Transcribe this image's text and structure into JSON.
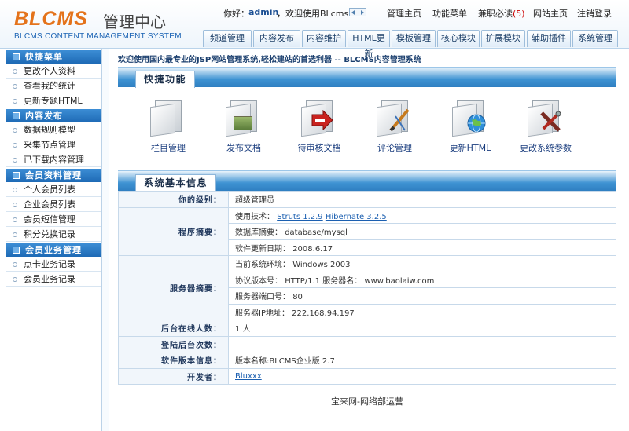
{
  "header": {
    "logo_main": "BLCMS",
    "logo_cn": "管理中心",
    "logo_sub": "BLCMS CONTENT MANAGEMENT SYSTEM",
    "greeting_prefix": "你好：",
    "username": "admin",
    "greeting_suffix": "，欢迎使用BLcms.",
    "links": [
      "管理主页",
      "功能菜单",
      "兼职必读",
      "网站主页",
      "注销登录"
    ],
    "parttime_count": "(5)"
  },
  "nav_tabs": [
    "频道管理",
    "内容发布",
    "内容维护",
    "HTML更新",
    "模板管理",
    "核心模块",
    "扩展模块",
    "辅助插件",
    "系统管理"
  ],
  "sidebar": {
    "sections": [
      {
        "title": "快捷菜单",
        "items": [
          "更改个人资料",
          "查看我的统计",
          "更新专题HTML"
        ]
      },
      {
        "title": "内容发布",
        "items": [
          "数据规则模型",
          "采集节点管理",
          "已下载内容管理"
        ]
      },
      {
        "title": "会员资料管理",
        "items": [
          "个人会员列表",
          "企业会员列表",
          "会员短信管理",
          "积分兑换记录"
        ]
      },
      {
        "title": "会员业务管理",
        "items": [
          "点卡业务记录",
          "会员业务记录"
        ]
      }
    ]
  },
  "main": {
    "welcome": "欢迎使用国内最专业的JSP网站管理系统,轻松建站的首选利器 -- BLCMS内容管理系统",
    "quick_title": "快捷功能",
    "quick_items": [
      {
        "label": "栏目管理",
        "icon": "folder-icon"
      },
      {
        "label": "发布文档",
        "icon": "document-icon"
      },
      {
        "label": "待审核文档",
        "icon": "pending-document-icon"
      },
      {
        "label": "评论管理",
        "icon": "comment-icon"
      },
      {
        "label": "更新HTML",
        "icon": "globe-icon"
      },
      {
        "label": "更改系统参数",
        "icon": "tools-icon"
      }
    ],
    "info_title": "系统基本信息",
    "info": {
      "level_key": "你的级别：",
      "level_val": "超级管理员",
      "program_key": "程序摘要：",
      "tech_label": "使用技术：",
      "tech_struts": "Struts 1.2.9",
      "tech_hibernate": "Hibernate 3.2.5",
      "db_label": "数据库摘要：",
      "db_val": "database/mysql",
      "update_label": "软件更新日期：",
      "update_val": "2008.6.17",
      "server_key": "服务器摘要：",
      "env_label": "当前系统环境：",
      "env_val": "Windows 2003",
      "proto_label": "协议版本号：",
      "proto_val": "HTTP/1.1",
      "sname_label": "服务器名：",
      "sname_val": "www.baolaiw.com",
      "port_label": "服务器端口号：",
      "port_val": "80",
      "ip_label": "服务器IP地址：",
      "ip_val": "222.168.94.197",
      "online_key": "后台在线人数：",
      "online_val": "1 人",
      "logins_key": "登陆后台次数：",
      "logins_val": "",
      "version_key": "软件版本信息：",
      "version_val": "版本名称:BLCMS企业版 2.7",
      "dev_key": "开发者：",
      "dev_val": "Bluxxx"
    },
    "footer": "宝来网-网络部运营"
  },
  "colors": {
    "accent": "#1e6ab5",
    "bar_blue": "#3f93d3",
    "link": "#1b5fb0",
    "warn": "#cc0000"
  }
}
